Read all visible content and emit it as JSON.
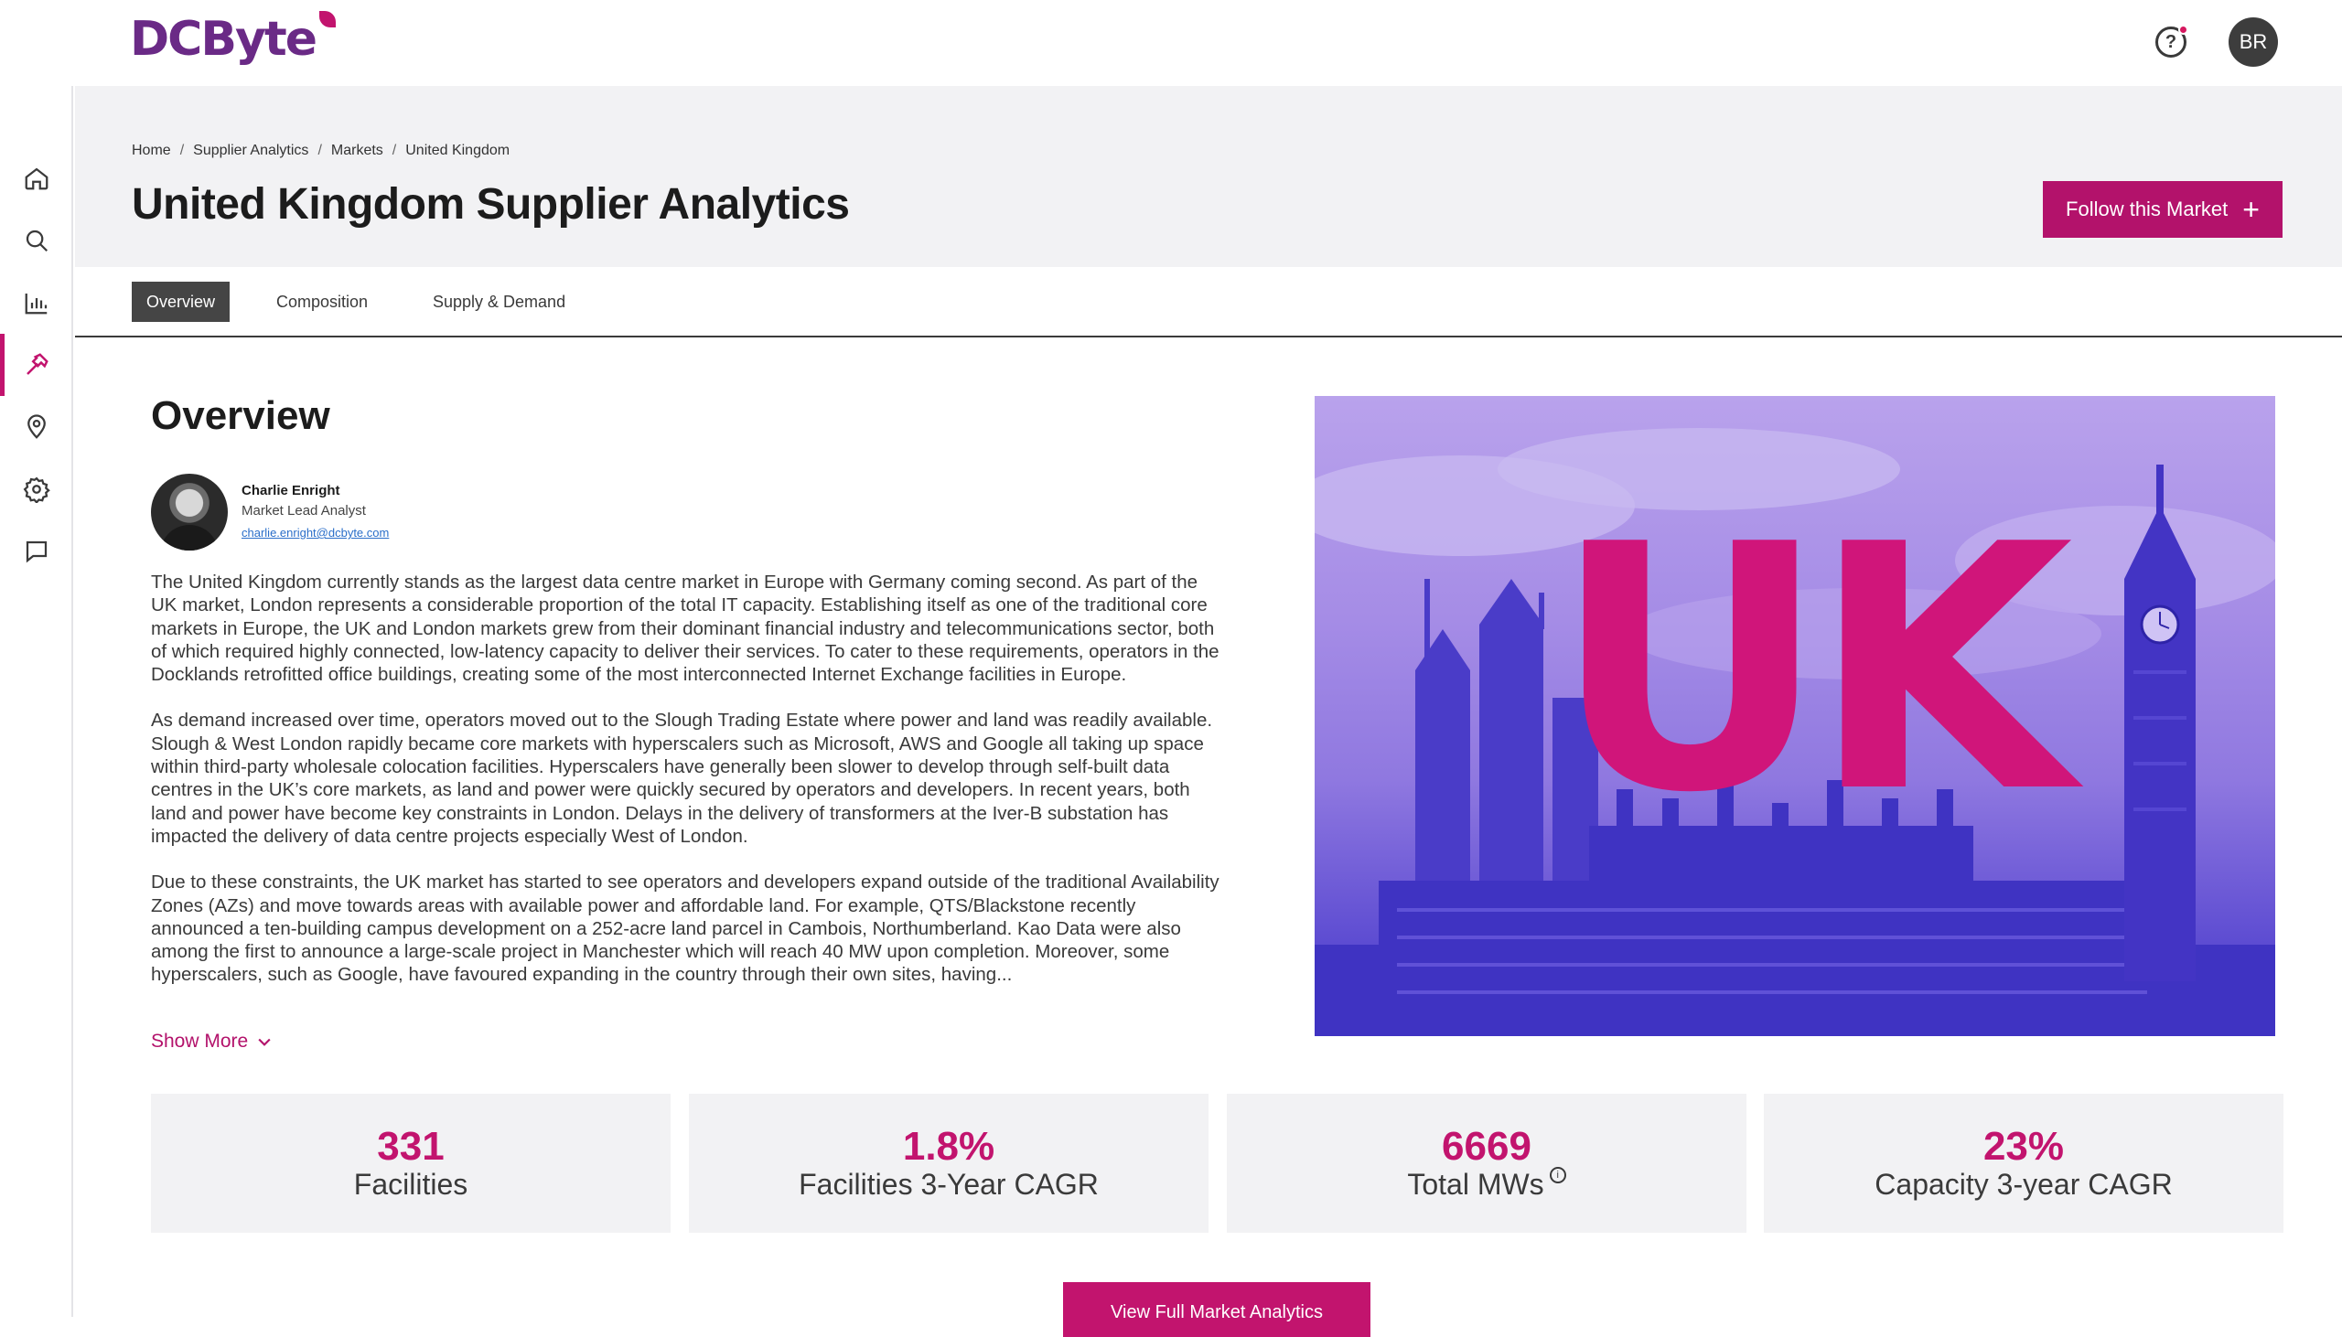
{
  "brand": {
    "logo_text": "DCByte",
    "accent": "#b3126b",
    "logo_color": "#6a2a86"
  },
  "topbar": {
    "help_icon": "help-circle-icon",
    "avatar_initials": "BR"
  },
  "sidebar": {
    "items": [
      {
        "icon": "home-icon",
        "active": false
      },
      {
        "icon": "search-icon",
        "active": false
      },
      {
        "icon": "bar-chart-icon",
        "active": false
      },
      {
        "icon": "hammer-icon",
        "active": true
      },
      {
        "icon": "location-pin-icon",
        "active": false
      },
      {
        "icon": "gear-icon",
        "active": false
      },
      {
        "icon": "chat-icon",
        "active": false
      }
    ]
  },
  "breadcrumb": [
    "Home",
    "Supplier Analytics",
    "Markets",
    "United Kingdom"
  ],
  "page": {
    "title": "United Kingdom Supplier Analytics",
    "follow_label": "Follow this Market"
  },
  "tabs": [
    "Overview",
    "Composition",
    "Supply & Demand"
  ],
  "overview": {
    "heading": "Overview",
    "analyst": {
      "name": "Charlie Enright",
      "role": "Market Lead Analyst",
      "email": "charlie.enright@dcbyte.com"
    },
    "paragraphs": [
      "The United Kingdom currently stands as the largest data centre market in Europe with Germany coming second. As part of the UK market, London represents a considerable proportion of the total IT capacity. Establishing itself as one of the traditional core markets in Europe, the UK and London markets grew from their dominant financial industry and telecommunications sector, both of which required highly connected, low-latency capacity to deliver their services. To cater to these requirements, operators in the Docklands retrofitted office buildings, creating some of the most interconnected Internet Exchange facilities in Europe.",
      "As demand increased over time, operators moved out to the Slough Trading Estate where power and land was readily available. Slough & West London rapidly became core markets with hyperscalers such as Microsoft, AWS and Google all taking up space within third-party wholesale colocation facilities. Hyperscalers have generally been slower to develop through self-built data centres in the UK’s core markets, as land and power were quickly secured by operators and developers. In recent years, both land and power have become key constraints in London. Delays in the delivery of transformers at the Iver-B substation has impacted the delivery of data centre projects especially West of London.",
      "Due to these constraints, the UK market has started to see operators and developers expand outside of the traditional Availability Zones (AZs) and move towards areas with available power and affordable land. For example, QTS/Blackstone recently announced a ten-building campus development on a 252-acre land parcel in Cambois, Northumberland. Kao Data were also among the first to announce a large-scale project in Manchester which will reach 40 MW upon completion. Moreover, some hyperscalers, such as Google, have favoured expanding in the country through their own sites, having..."
    ],
    "show_more": "Show More",
    "hero_text": "UK"
  },
  "stats": [
    {
      "value": "331",
      "label": "Facilities",
      "info": false
    },
    {
      "value": "1.8%",
      "label": "Facilities 3-Year CAGR",
      "info": false
    },
    {
      "value": "6669",
      "label": "Total MWs",
      "info": true
    },
    {
      "value": "23%",
      "label": "Capacity 3-year CAGR",
      "info": false
    }
  ],
  "cta": {
    "label": "View Full Market Analytics"
  }
}
